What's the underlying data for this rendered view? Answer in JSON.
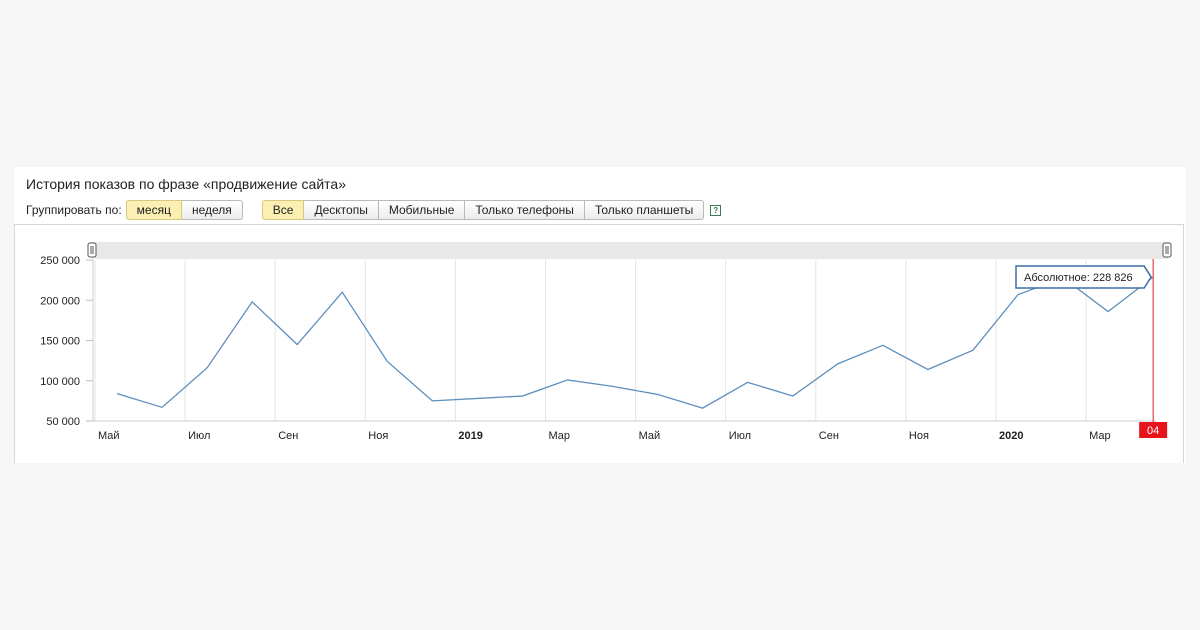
{
  "header": {
    "title": "История показов по фразе «продвижение сайта»"
  },
  "controls": {
    "group_label": "Группировать по:",
    "group_buttons": [
      {
        "label": "месяц",
        "active": true
      },
      {
        "label": "неделя",
        "active": false
      }
    ],
    "device_buttons": [
      {
        "label": "Все",
        "active": true
      },
      {
        "label": "Десктопы",
        "active": false
      },
      {
        "label": "Мобильные",
        "active": false
      },
      {
        "label": "Только телефоны",
        "active": false
      },
      {
        "label": "Только планшеты",
        "active": false
      }
    ],
    "help_icon": "question-icon"
  },
  "colors": {
    "line": "#5f8fbd",
    "grid": "#e3e3e3",
    "marker": "#e02020",
    "marker_label_bg": "#e8141c",
    "tooltip_border": "#3d6fa6",
    "active_button": "#fcefb3"
  },
  "chart_data": {
    "type": "line",
    "x": [
      "2018-05",
      "2018-06",
      "2018-07",
      "2018-08",
      "2018-09",
      "2018-10",
      "2018-11",
      "2018-12",
      "2019-01",
      "2019-02",
      "2019-03",
      "2019-04",
      "2019-05",
      "2019-06",
      "2019-07",
      "2019-08",
      "2019-09",
      "2019-10",
      "2019-11",
      "2019-12",
      "2020-01",
      "2020-02",
      "2020-03",
      "2020-04"
    ],
    "values": [
      84000,
      67000,
      116000,
      198000,
      145000,
      210000,
      124000,
      75000,
      78000,
      81000,
      101000,
      93000,
      83000,
      66000,
      98000,
      81000,
      121000,
      144000,
      114000,
      138000,
      207000,
      228000,
      186000,
      228826
    ],
    "x_tick_labels": [
      {
        "x": "2018-05",
        "label": "Май",
        "bold": false
      },
      {
        "x": "2018-07",
        "label": "Июл",
        "bold": false
      },
      {
        "x": "2018-09",
        "label": "Сен",
        "bold": false
      },
      {
        "x": "2018-11",
        "label": "Ноя",
        "bold": false
      },
      {
        "x": "2019-01",
        "label": "2019",
        "bold": true
      },
      {
        "x": "2019-03",
        "label": "Мар",
        "bold": false
      },
      {
        "x": "2019-05",
        "label": "Май",
        "bold": false
      },
      {
        "x": "2019-07",
        "label": "Июл",
        "bold": false
      },
      {
        "x": "2019-09",
        "label": "Сен",
        "bold": false
      },
      {
        "x": "2019-11",
        "label": "Ноя",
        "bold": false
      },
      {
        "x": "2020-01",
        "label": "2020",
        "bold": true
      },
      {
        "x": "2020-03",
        "label": "Мар",
        "bold": false
      }
    ],
    "y_ticks": [
      {
        "value": 50000,
        "label": "50 000"
      },
      {
        "value": 100000,
        "label": "100 000"
      },
      {
        "value": 150000,
        "label": "150 000"
      },
      {
        "value": 200000,
        "label": "200 000"
      },
      {
        "value": 250000,
        "label": "250 000"
      }
    ],
    "ylim": [
      50000,
      250000
    ],
    "grid": true,
    "marker": {
      "x": "2020-04",
      "label": "04"
    },
    "tooltip": {
      "text": "Абсолютное: 228 826"
    }
  }
}
